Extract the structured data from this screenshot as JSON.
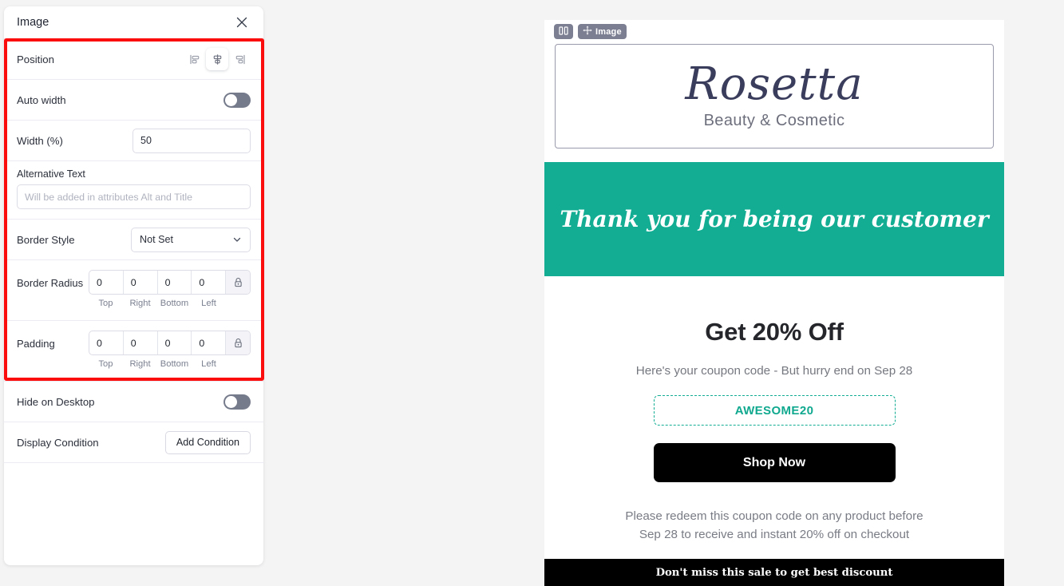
{
  "panel": {
    "title": "Image",
    "close_icon": "close-icon",
    "rows": {
      "position": {
        "label": "Position",
        "options": [
          {
            "name": "align-left-icon",
            "selected": false
          },
          {
            "name": "align-center-icon",
            "selected": true
          },
          {
            "name": "align-right-icon",
            "selected": false
          }
        ]
      },
      "auto_width": {
        "label": "Auto width",
        "value": "off"
      },
      "width": {
        "label": "Width (%)",
        "value": "50",
        "placeholder": ""
      },
      "alternative_text": {
        "label": "Alternative Text",
        "value": "",
        "placeholder": "Will be added in attributes Alt and Title"
      },
      "border_style": {
        "label": "Border Style",
        "value": "Not Set",
        "options": [
          "Not Set"
        ]
      },
      "border_radius": {
        "label": "Border Radius",
        "values": [
          "0",
          "0",
          "0",
          "0"
        ],
        "names": [
          "Top",
          "Right",
          "Bottom",
          "Left"
        ],
        "lock_icon": "lock-icon"
      },
      "padding": {
        "label": "Padding",
        "values": [
          "0",
          "0",
          "0",
          "0"
        ],
        "names": [
          "Top",
          "Right",
          "Bottom",
          "Left"
        ],
        "lock_icon": "lock-icon"
      },
      "hide_on_desktop": {
        "label": "Hide on Desktop",
        "value": "off"
      },
      "display_condition": {
        "label": "Display Condition",
        "button": "Add Condition"
      }
    }
  },
  "email": {
    "badges": {
      "columns_icon": "columns-icon",
      "move_icon": "move-icon",
      "block_label": "Image"
    },
    "logo": {
      "name": "Rosetta",
      "tagline": "Beauty & Cosmetic"
    },
    "banner": {
      "text": "Thank you for being our customer",
      "background": "#13ad94"
    },
    "offer": {
      "title": "Get 20% Off",
      "subtitle": "Here's your coupon code - But hurry end on Sep 28",
      "coupon_code": "AWESOME20",
      "cta": "Shop Now",
      "redeem_line1": "Please redeem this coupon code on any product before",
      "redeem_line2": "Sep 28 to receive and instant 20% off on checkout"
    },
    "footer": {
      "text": "Don't miss this sale to get best discount"
    }
  },
  "accent": {
    "teal": "#13ad94",
    "highlight": "#fc0d0d",
    "black": "#000000",
    "navy": "#3b3d5c"
  }
}
